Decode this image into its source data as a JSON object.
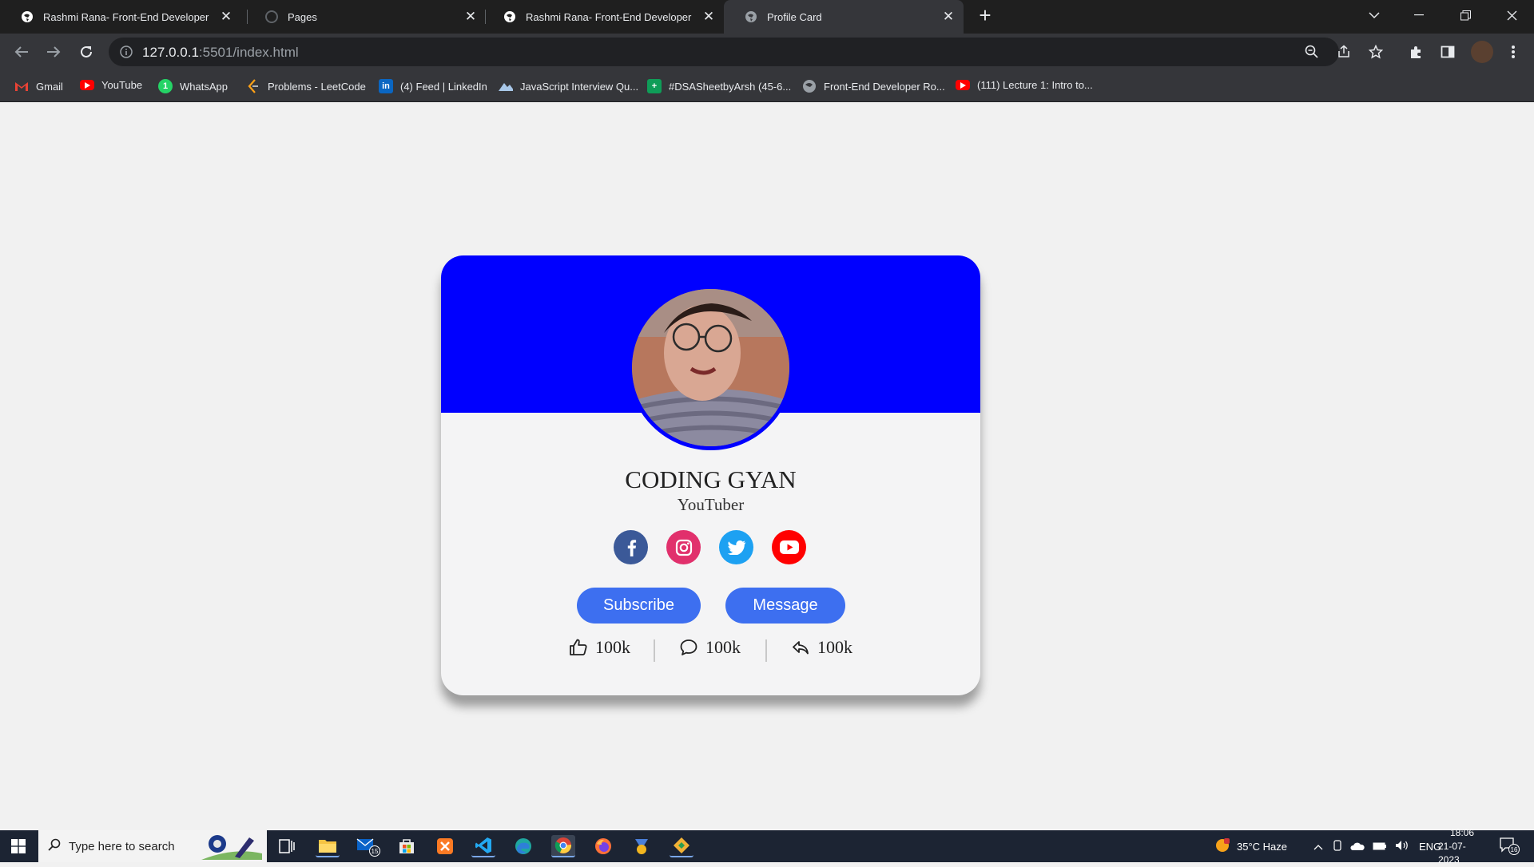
{
  "browser": {
    "tabs": [
      {
        "title": "Rashmi Rana- Front-End Developer",
        "active": false
      },
      {
        "title": "Pages",
        "active": false
      },
      {
        "title": "Rashmi Rana- Front-End Developer",
        "active": false
      },
      {
        "title": "Profile Card",
        "active": true
      }
    ],
    "url_host": "127.0.0.1",
    "url_path": ":5501/index.html",
    "bookmarks": [
      {
        "label": "Gmail",
        "icon": "gmail-icon"
      },
      {
        "label": "YouTube",
        "icon": "youtube-icon"
      },
      {
        "label": "WhatsApp",
        "icon": "whatsapp-icon"
      },
      {
        "label": "Problems - LeetCode",
        "icon": "leetcode-icon"
      },
      {
        "label": "(4) Feed | LinkedIn",
        "icon": "linkedin-icon"
      },
      {
        "label": "JavaScript Interview Qu...",
        "icon": "mountain-icon"
      },
      {
        "label": "#DSASheetbyArsh (45-6...",
        "icon": "sheets-icon"
      },
      {
        "label": "Front-End Developer Ro...",
        "icon": "globe-icon"
      },
      {
        "label": "(111) Lecture 1: Intro to...",
        "icon": "youtube-icon"
      }
    ]
  },
  "profile": {
    "name": "CODING GYAN",
    "role": "YouTuber",
    "social": [
      "facebook-icon",
      "instagram-icon",
      "twitter-icon",
      "youtube-icon"
    ],
    "buttons": {
      "subscribe": "Subscribe",
      "message": "Message"
    },
    "stats": {
      "likes": "100k",
      "comments": "100k",
      "shares": "100k"
    }
  },
  "colors": {
    "banner": "#0000ff",
    "button": "#3d6ff0",
    "facebook": "#3b5998",
    "instagram": "#e1306c",
    "twitter": "#1da1f2",
    "youtube": "#ff0000"
  },
  "taskbar": {
    "search_placeholder": "Type here to search",
    "mail_badge": "15",
    "weather": "35°C  Haze",
    "lang": "ENG",
    "time": "18:06",
    "date": "21-07-2023",
    "notif_count": "16"
  }
}
